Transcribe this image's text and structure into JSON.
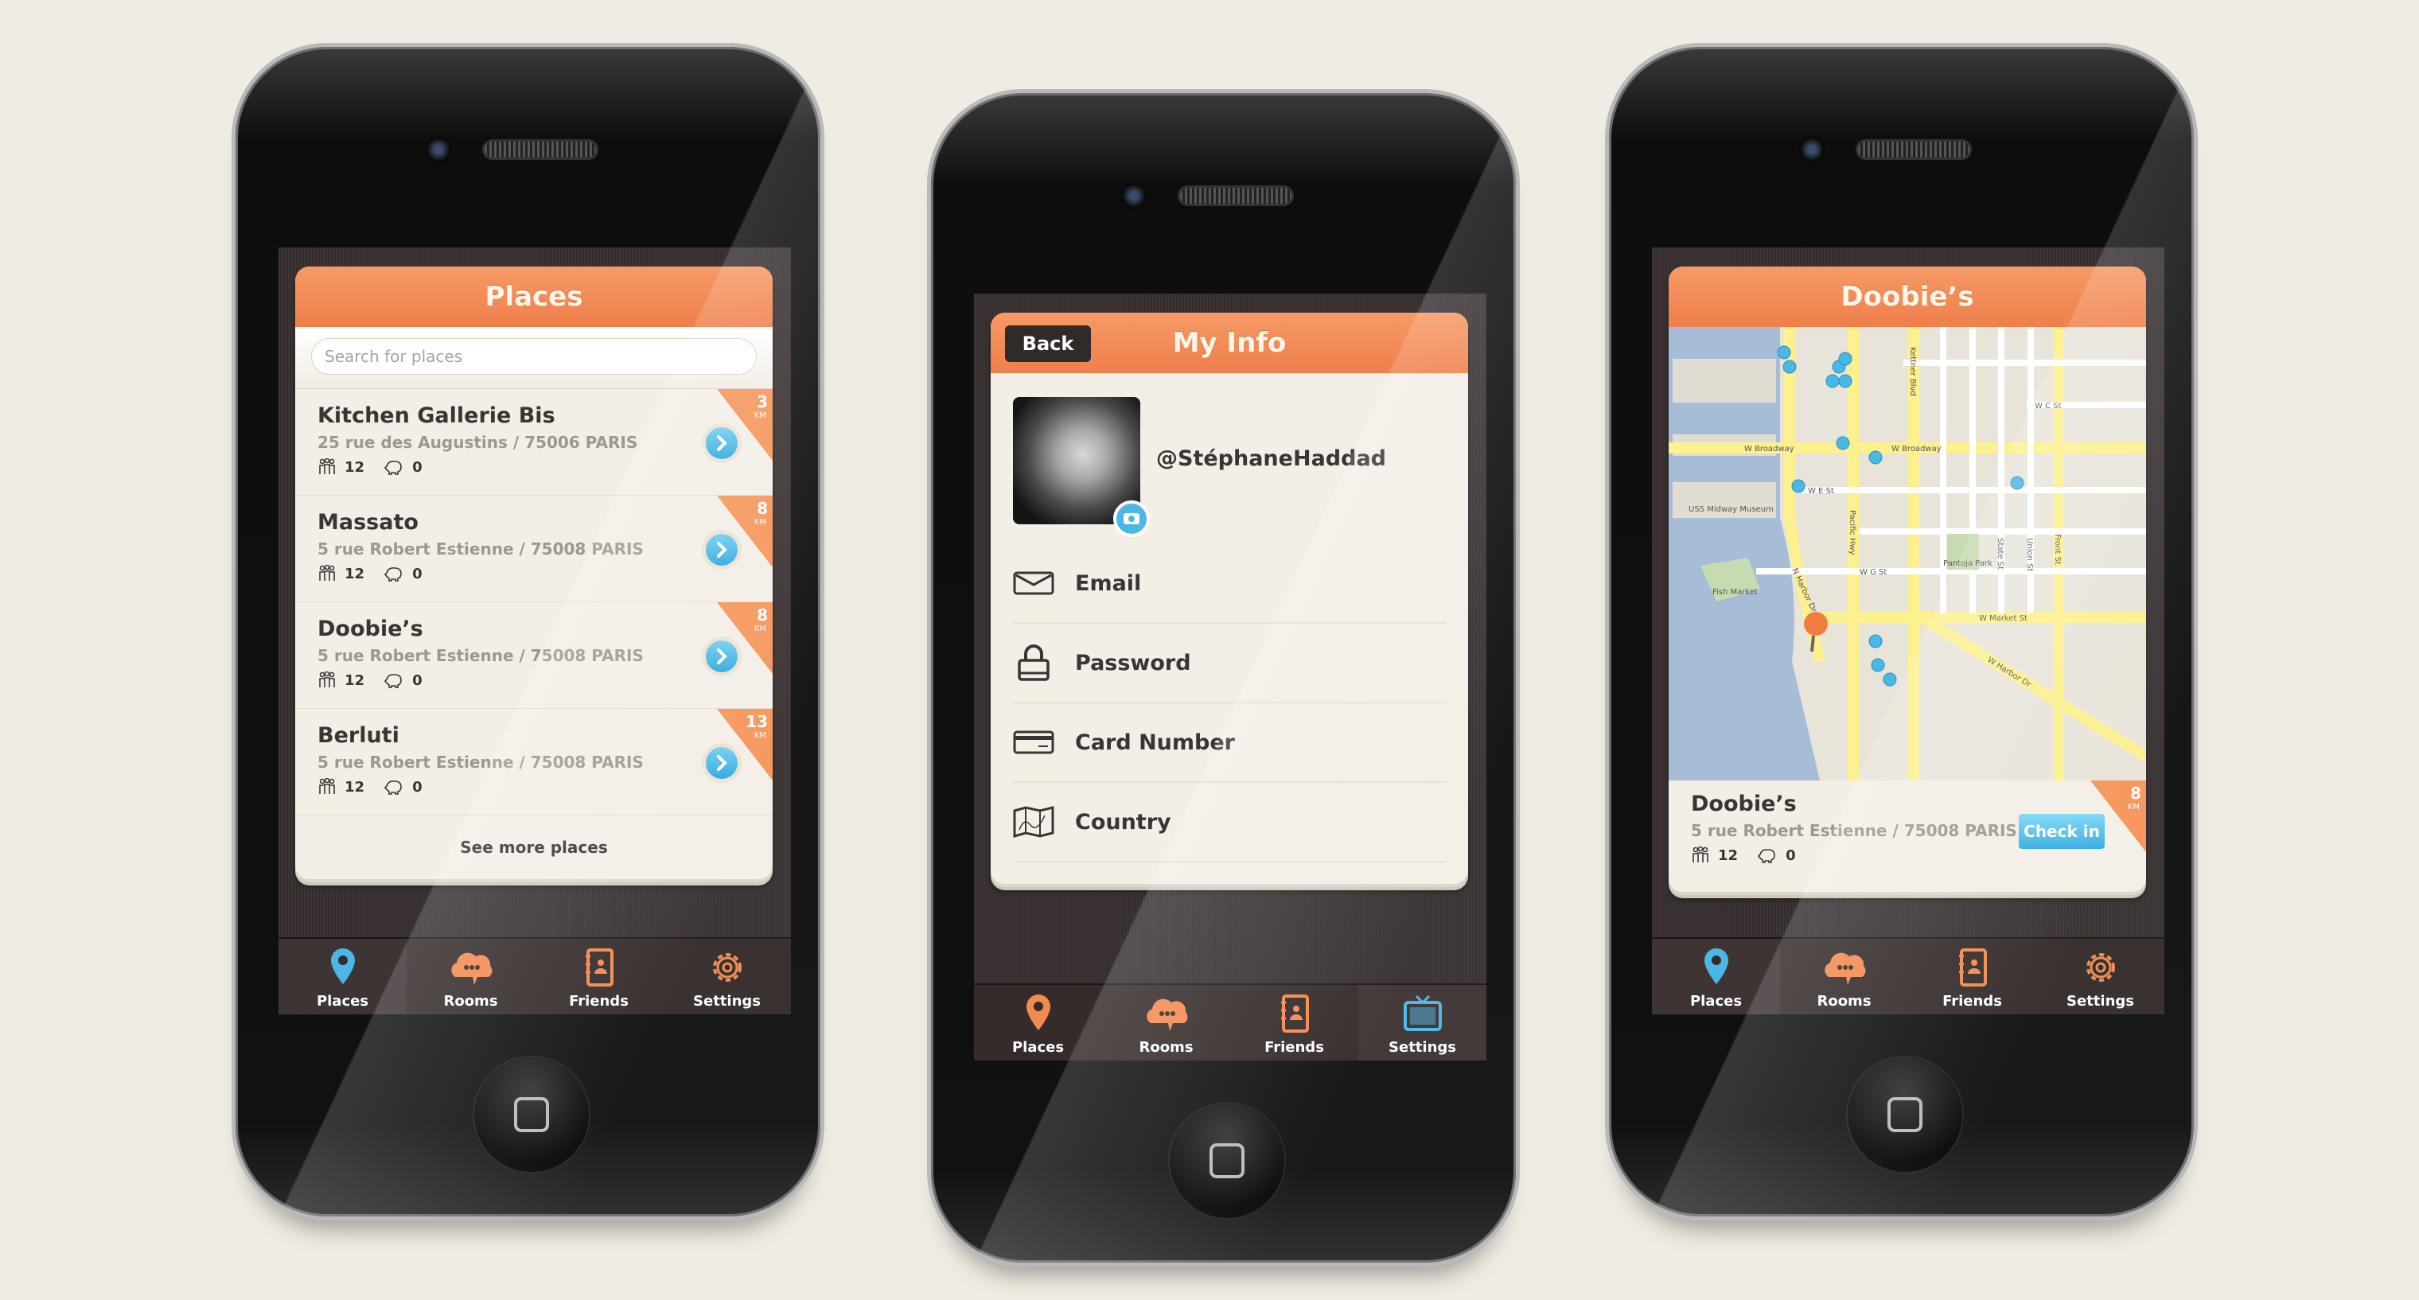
{
  "colors": {
    "accent": "#ef7f4b",
    "blue": "#34ace0",
    "background": "#f1ece3"
  },
  "tabs": [
    {
      "label": "Places",
      "icon": "map-pin-icon"
    },
    {
      "label": "Rooms",
      "icon": "chat-cloud-icon"
    },
    {
      "label": "Friends",
      "icon": "address-book-icon"
    },
    {
      "label": "Settings",
      "icon": "gear-icon"
    }
  ],
  "places_screen": {
    "title": "Places",
    "search_placeholder": "Search for places",
    "items": [
      {
        "name": "Kitchen Gallerie Bis",
        "address": "25 rue des Augustins / 75006 PARIS",
        "people": "12",
        "deals": "0",
        "distance": "3",
        "unit": "KM"
      },
      {
        "name": "Massato",
        "address": "5 rue Robert Estienne / 75008 PARIS",
        "people": "12",
        "deals": "0",
        "distance": "8",
        "unit": "KM"
      },
      {
        "name": "Doobie’s",
        "address": "5 rue Robert Estienne / 75008 PARIS",
        "people": "12",
        "deals": "0",
        "distance": "8",
        "unit": "KM"
      },
      {
        "name": "Berluti",
        "address": "5 rue Robert Estienne / 75008 PARIS",
        "people": "12",
        "deals": "0",
        "distance": "13",
        "unit": "KM"
      }
    ],
    "see_more": "See more places",
    "active_tab": "Places"
  },
  "info_screen": {
    "title": "My Info",
    "back": "Back",
    "handle": "@StéphaneHaddad",
    "fields": [
      "Email",
      "Password",
      "Card Number",
      "Country"
    ],
    "active_tab": "Settings"
  },
  "map_screen": {
    "title": "Doobie’s",
    "map_labels": [
      "W Broadway",
      "W Broadway",
      "Kettner Blvd",
      "Pacific Hwy",
      "N Harbor Dr",
      "W Market St",
      "W Harbor Dr",
      "W E St",
      "W G St",
      "W C St",
      "Front St",
      "State St",
      "Union St",
      "Pantoja Park",
      "USS Midway Museum",
      "Fish Market"
    ],
    "place": {
      "name": "Doobie’s",
      "address": "5 rue Robert Estienne / 75008 PARIS",
      "people": "12",
      "deals": "0",
      "distance": "8",
      "unit": "KM"
    },
    "check_in": "Check in",
    "active_tab": "Places"
  }
}
